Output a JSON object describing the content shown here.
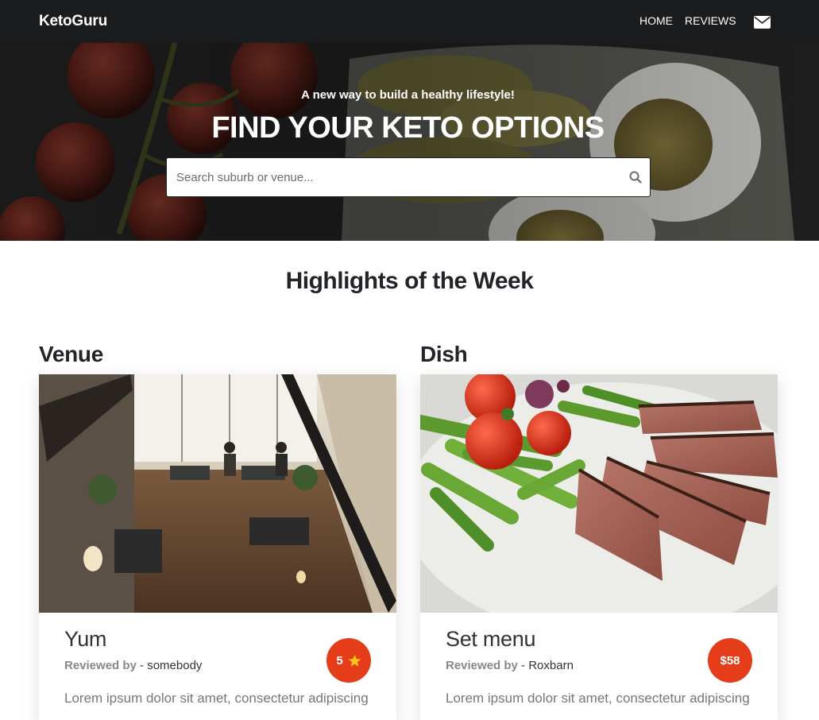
{
  "navbar": {
    "brand": "KetoGuru",
    "links": [
      {
        "label": "HOME"
      },
      {
        "label": "REVIEWS"
      }
    ],
    "mail_icon": "envelope-icon"
  },
  "hero": {
    "subtitle": "A new way to build a healthy lifestyle!",
    "title": "FIND YOUR KETO OPTIONS",
    "search": {
      "placeholder": "Search suburb or venue...",
      "value": "",
      "icon": "search-icon"
    }
  },
  "highlights": {
    "title": "Highlights of the Week",
    "venue": {
      "heading": "Venue",
      "name": "Yum",
      "reviewed_by_label": "Reviewed by",
      "reviewer": "- somebody",
      "badge_value": "5",
      "badge_icon": "star-icon",
      "description": "Lorem ipsum dolor sit amet, consectetur adipiscing"
    },
    "dish": {
      "heading": "Dish",
      "name": "Set menu",
      "reviewed_by_label": "Reviewed by",
      "reviewer": "- Roxbarn",
      "badge_value": "$58",
      "description": "Lorem ipsum dolor sit amet, consectetur adipiscing"
    }
  },
  "colors": {
    "navbar": "#1b1c1e",
    "badge": "#e53c1a",
    "star": "#f5c518"
  }
}
